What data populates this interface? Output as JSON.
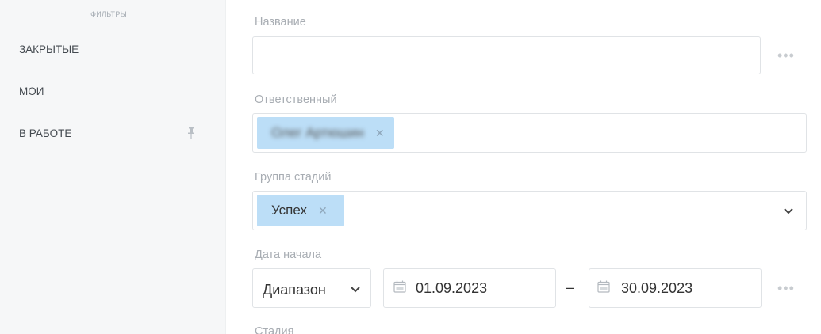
{
  "sidebar": {
    "header": "ФИЛЬТРЫ",
    "items": [
      {
        "label": "ЗАКРЫТЫЕ",
        "pinned": false
      },
      {
        "label": "МОИ",
        "pinned": false
      },
      {
        "label": "В РАБОТЕ",
        "pinned": true
      }
    ]
  },
  "form": {
    "name": {
      "label": "Название",
      "value": ""
    },
    "responsible": {
      "label": "Ответственный",
      "tags": [
        "Олег Артюшин"
      ]
    },
    "stage_group": {
      "label": "Группа стадий",
      "tags": [
        "Успех"
      ]
    },
    "start_date": {
      "label": "Дата начала",
      "mode": "Диапазон",
      "from": "01.09.2023",
      "separator": "–",
      "to": "30.09.2023"
    },
    "next_label": "Стадия",
    "more_icon": "•••"
  },
  "colors": {
    "tag_bg": "#bcdef7",
    "sidebar_bg": "#f6f7f8",
    "label": "#a8adb3"
  }
}
